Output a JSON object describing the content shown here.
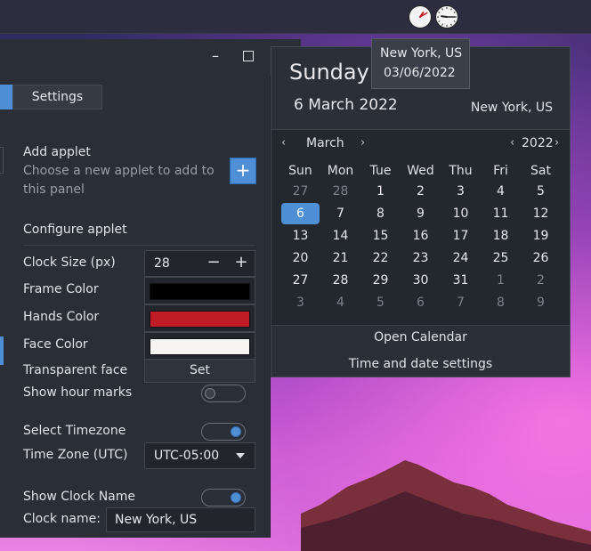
{
  "desktop": {},
  "panel": {
    "clocks": [
      {
        "name": "clock-applet-1",
        "hours": 13,
        "minutes": 10
      },
      {
        "name": "clock-applet-2",
        "hours": 9,
        "minutes": 15
      }
    ]
  },
  "settings": {
    "tab_label": "Settings",
    "add_applet_title": "Add applet",
    "add_applet_desc": "Choose a new applet to add to this panel",
    "add_button_label": "+",
    "configure_title": "Configure applet",
    "clock_size_label": "Clock Size (px)",
    "clock_size_value": "28",
    "minus_label": "−",
    "plus_label": "+",
    "frame_color_label": "Frame Color",
    "frame_color": "#000000",
    "hands_color_label": "Hands Color",
    "hands_color": "#c01c28",
    "face_color_label": "Face Color",
    "face_color": "#f6f5f4",
    "transparent_face_label": "Transparent face",
    "set_label": "Set",
    "show_hour_marks_label": "Show hour marks",
    "show_hour_marks": false,
    "select_timezone_label": "Select Timezone",
    "select_timezone": true,
    "timezone_label": "Time Zone (UTC)",
    "timezone_value": "UTC-05:00",
    "show_clock_name_label": "Show Clock Name",
    "show_clock_name": true,
    "clock_name_label": "Clock name:",
    "clock_name_value": "New York, US"
  },
  "calendar": {
    "day_name": "Sunday",
    "full_date": "6 March 2022",
    "location": "New York, US",
    "month": "March",
    "year": "2022",
    "prev_month": "‹",
    "next_month": "›",
    "prev_year": "‹",
    "next_year": "›",
    "weekdays": [
      "Sun",
      "Mon",
      "Tue",
      "Wed",
      "Thu",
      "Fri",
      "Sat"
    ],
    "weeks": [
      [
        "27",
        "28",
        "1",
        "2",
        "3",
        "4",
        "5"
      ],
      [
        "6",
        "7",
        "8",
        "9",
        "10",
        "11",
        "12"
      ],
      [
        "13",
        "14",
        "15",
        "16",
        "17",
        "18",
        "19"
      ],
      [
        "20",
        "21",
        "22",
        "23",
        "24",
        "25",
        "26"
      ],
      [
        "27",
        "28",
        "29",
        "30",
        "31",
        "1",
        "2"
      ],
      [
        "3",
        "4",
        "5",
        "6",
        "7",
        "8",
        "9"
      ]
    ],
    "dim_cells": [
      [
        0,
        0
      ],
      [
        0,
        1
      ],
      [
        4,
        5
      ],
      [
        4,
        6
      ],
      [
        5,
        0
      ],
      [
        5,
        1
      ],
      [
        5,
        2
      ],
      [
        5,
        3
      ],
      [
        5,
        4
      ],
      [
        5,
        5
      ],
      [
        5,
        6
      ]
    ],
    "today_cell": [
      1,
      0
    ],
    "open_calendar_label": "Open Calendar",
    "time_date_settings_label": "Time and date settings",
    "accent_color": "#4f8fd6"
  },
  "tooltip": {
    "title": "New York, US",
    "date": "03/06/2022"
  }
}
